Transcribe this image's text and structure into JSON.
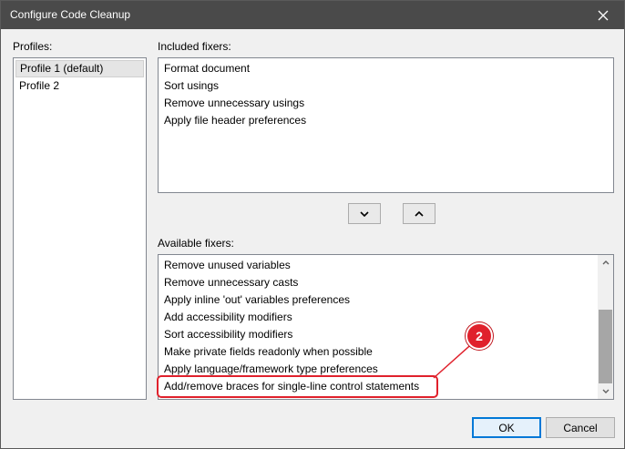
{
  "window": {
    "title": "Configure Code Cleanup"
  },
  "profiles": {
    "label": "Profiles:",
    "items": [
      "Profile 1 (default)",
      "Profile 2"
    ],
    "selected_index": 0
  },
  "included": {
    "label": "Included fixers:",
    "items": [
      "Format document",
      "Sort usings",
      "Remove unnecessary usings",
      "Apply file header preferences"
    ]
  },
  "move": {
    "down_icon": "chevron-down-icon",
    "up_icon": "chevron-up-icon"
  },
  "available": {
    "label": "Available fixers:",
    "items": [
      "Remove unused variables",
      "Remove unnecessary casts",
      "Apply inline 'out' variables preferences",
      "Add accessibility modifiers",
      "Sort accessibility modifiers",
      "Make private fields readonly when possible",
      "Apply language/framework type preferences",
      "Add/remove braces for single-line control statements"
    ],
    "highlighted_index": 7
  },
  "annotation": {
    "number": "2",
    "color": "#e0212c"
  },
  "footer": {
    "ok_label": "OK",
    "cancel_label": "Cancel"
  },
  "colors": {
    "titlebar": "#4a4a4a",
    "accent": "#0078d7"
  }
}
